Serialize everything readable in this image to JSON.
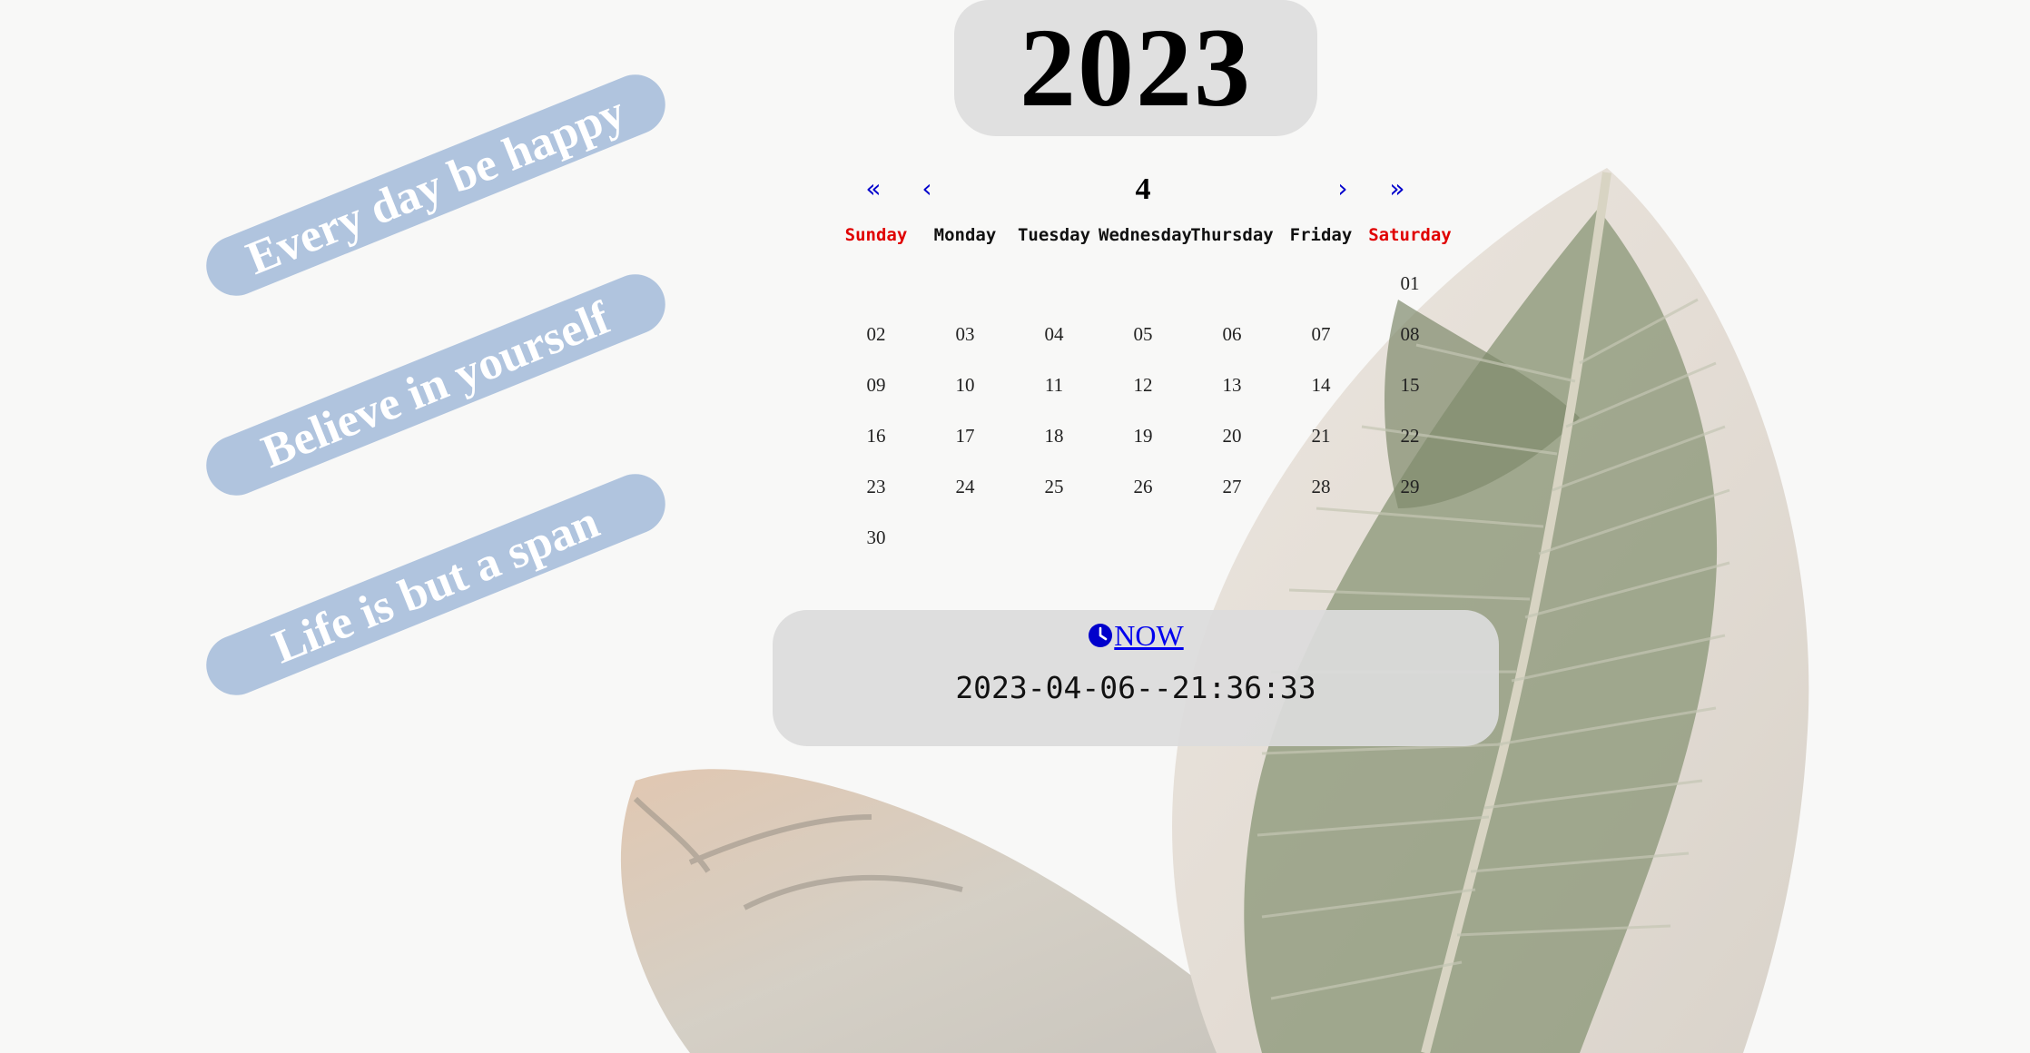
{
  "year": "2023",
  "quotes": [
    "Every day be happy",
    "Believe in yourself",
    "Life is but a span"
  ],
  "calendar": {
    "nav": {
      "prev_year": "«",
      "prev_month": "‹",
      "month": "4",
      "next_month": "›",
      "next_year": "»"
    },
    "weekdays": [
      "Sunday",
      "Monday",
      "Tuesday",
      "Wednesday",
      "Thursday",
      "Friday",
      "Saturday"
    ],
    "first_weekday_index": 6,
    "days": [
      "01",
      "02",
      "03",
      "04",
      "05",
      "06",
      "07",
      "08",
      "09",
      "10",
      "11",
      "12",
      "13",
      "14",
      "15",
      "16",
      "17",
      "18",
      "19",
      "20",
      "21",
      "22",
      "23",
      "24",
      "25",
      "26",
      "27",
      "28",
      "29",
      "30"
    ],
    "weekend_color": "#e00000",
    "nav_color": "#0000cc"
  },
  "now": {
    "link_label": "NOW",
    "icon": "clock-icon",
    "datetime": "2023-04-06--21:36:33"
  },
  "colors": {
    "banner": "#b0c4de",
    "panel": "#e0e0e0",
    "background": "#f8f8f7"
  }
}
